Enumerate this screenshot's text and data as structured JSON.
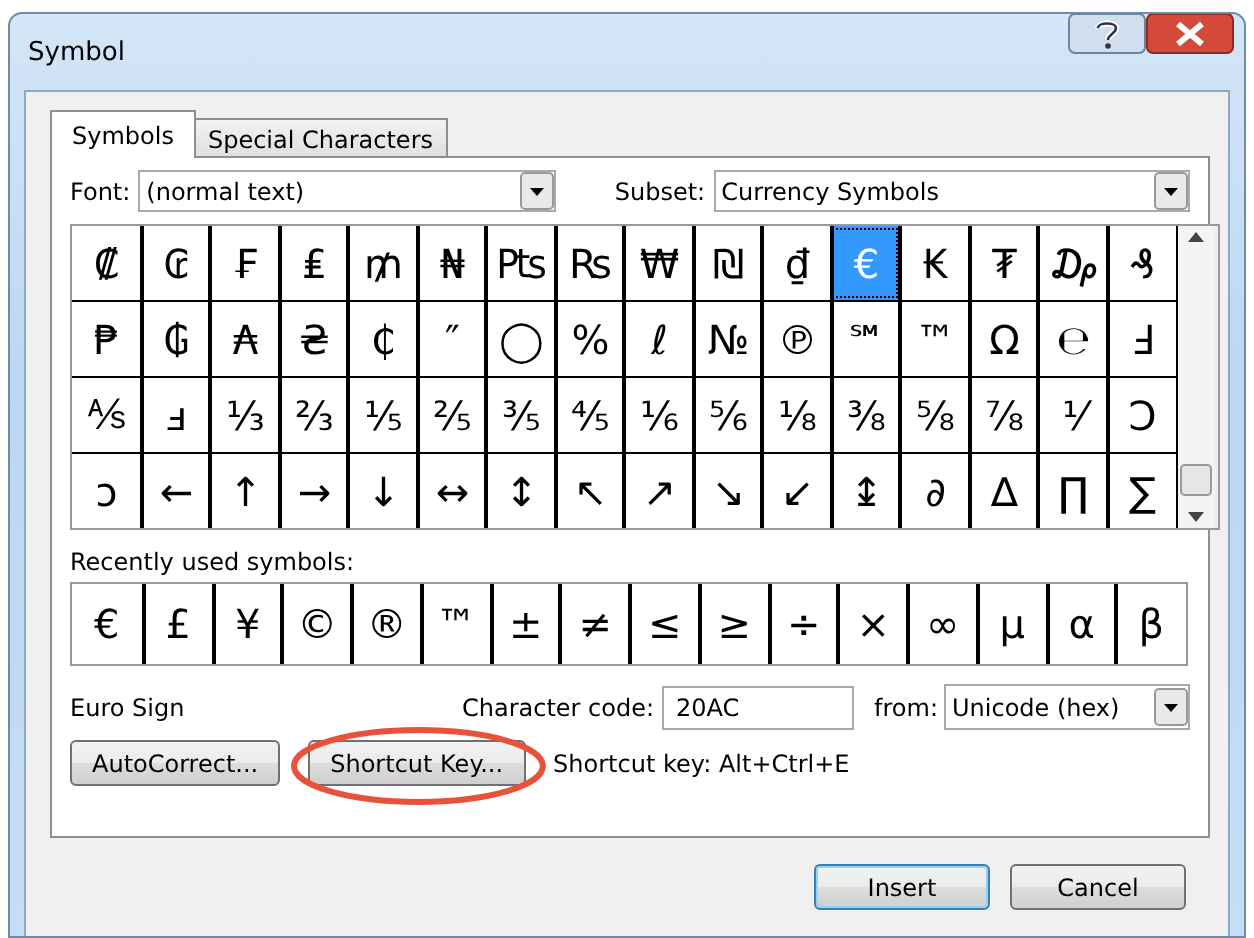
{
  "window": {
    "title": "Symbol"
  },
  "tabs": [
    {
      "label": "Symbols",
      "selected": true
    },
    {
      "label": "Special Characters",
      "selected": false
    }
  ],
  "font": {
    "label": "Font:",
    "value": "(normal text)"
  },
  "subset": {
    "label": "Subset:",
    "value": "Currency Symbols"
  },
  "symbols": [
    {
      "char": "₡",
      "selected": false
    },
    {
      "char": "₢",
      "selected": false
    },
    {
      "char": "₣",
      "selected": false
    },
    {
      "char": "₤",
      "selected": false
    },
    {
      "char": "₥",
      "selected": false
    },
    {
      "char": "₦",
      "selected": false
    },
    {
      "char": "₧",
      "selected": false
    },
    {
      "char": "₨",
      "selected": false
    },
    {
      "char": "₩",
      "selected": false
    },
    {
      "char": "₪",
      "selected": false
    },
    {
      "char": "₫",
      "selected": false
    },
    {
      "char": "€",
      "selected": true
    },
    {
      "char": "₭",
      "selected": false
    },
    {
      "char": "₮",
      "selected": false
    },
    {
      "char": "₯",
      "selected": false
    },
    {
      "char": "₰",
      "selected": false
    },
    {
      "char": "₱",
      "selected": false
    },
    {
      "char": "₲",
      "selected": false
    },
    {
      "char": "₳",
      "selected": false
    },
    {
      "char": "₴",
      "selected": false
    },
    {
      "char": "₵",
      "selected": false
    },
    {
      "char": "″",
      "selected": false
    },
    {
      "char": "◯",
      "selected": false
    },
    {
      "char": "%",
      "selected": false
    },
    {
      "char": "ℓ",
      "selected": false
    },
    {
      "char": "№",
      "selected": false
    },
    {
      "char": "℗",
      "selected": false
    },
    {
      "char": "℠",
      "selected": false
    },
    {
      "char": "™",
      "selected": false
    },
    {
      "char": "Ω",
      "selected": false
    },
    {
      "char": "℮",
      "selected": false
    },
    {
      "char": "Ⅎ",
      "selected": false
    },
    {
      "char": "⅍",
      "selected": false
    },
    {
      "char": "ⅎ",
      "selected": false
    },
    {
      "char": "⅓",
      "selected": false
    },
    {
      "char": "⅔",
      "selected": false
    },
    {
      "char": "⅕",
      "selected": false
    },
    {
      "char": "⅖",
      "selected": false
    },
    {
      "char": "⅗",
      "selected": false
    },
    {
      "char": "⅘",
      "selected": false
    },
    {
      "char": "⅙",
      "selected": false
    },
    {
      "char": "⅚",
      "selected": false
    },
    {
      "char": "⅛",
      "selected": false
    },
    {
      "char": "⅜",
      "selected": false
    },
    {
      "char": "⅝",
      "selected": false
    },
    {
      "char": "⅞",
      "selected": false
    },
    {
      "char": "⅟",
      "selected": false
    },
    {
      "char": "Ↄ",
      "selected": false
    },
    {
      "char": "ↄ",
      "selected": false
    },
    {
      "char": "←",
      "selected": false
    },
    {
      "char": "↑",
      "selected": false
    },
    {
      "char": "→",
      "selected": false
    },
    {
      "char": "↓",
      "selected": false
    },
    {
      "char": "↔",
      "selected": false
    },
    {
      "char": "↕",
      "selected": false
    },
    {
      "char": "↖",
      "selected": false
    },
    {
      "char": "↗",
      "selected": false
    },
    {
      "char": "↘",
      "selected": false
    },
    {
      "char": "↙",
      "selected": false
    },
    {
      "char": "↨",
      "selected": false
    },
    {
      "char": "∂",
      "selected": false
    },
    {
      "char": "∆",
      "selected": false
    },
    {
      "char": "∏",
      "selected": false
    },
    {
      "char": "∑",
      "selected": false
    }
  ],
  "recent": {
    "label": "Recently used symbols:",
    "symbols": [
      "€",
      "£",
      "¥",
      "©",
      "®",
      "™",
      "±",
      "≠",
      "≤",
      "≥",
      "÷",
      "×",
      "∞",
      "µ",
      "α",
      "β"
    ]
  },
  "character_name": "Euro Sign",
  "character_code": {
    "label": "Character code:",
    "value": "20AC"
  },
  "from": {
    "label": "from:",
    "value": "Unicode (hex)"
  },
  "buttons": [
    {
      "label": "AutoCorrect...",
      "highlighted": false
    },
    {
      "label": "Shortcut Key...",
      "highlighted": true
    }
  ],
  "shortcut_text": "Shortcut key: Alt+Ctrl+E",
  "footer_buttons": [
    {
      "label": "Insert",
      "default": true
    },
    {
      "label": "Cancel",
      "default": false
    }
  ]
}
